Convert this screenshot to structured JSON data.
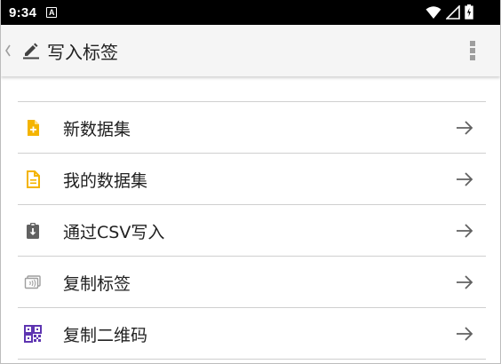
{
  "status_bar": {
    "time": "9:34",
    "notification_letter": "A"
  },
  "toolbar": {
    "title": "写入标签"
  },
  "colors": {
    "accent_yellow": "#f4b400",
    "icon_gray": "#616161",
    "light_gray": "#9e9e9e",
    "purple": "#5e35b1"
  },
  "menu": {
    "items": [
      {
        "label": "新数据集",
        "icon": "new-file-icon"
      },
      {
        "label": "我的数据集",
        "icon": "document-icon"
      },
      {
        "label": "通过CSV写入",
        "icon": "clipboard-download-icon"
      },
      {
        "label": "复制标签",
        "icon": "nfc-tag-icon"
      },
      {
        "label": "复制二维码",
        "icon": "qr-code-icon"
      }
    ]
  }
}
